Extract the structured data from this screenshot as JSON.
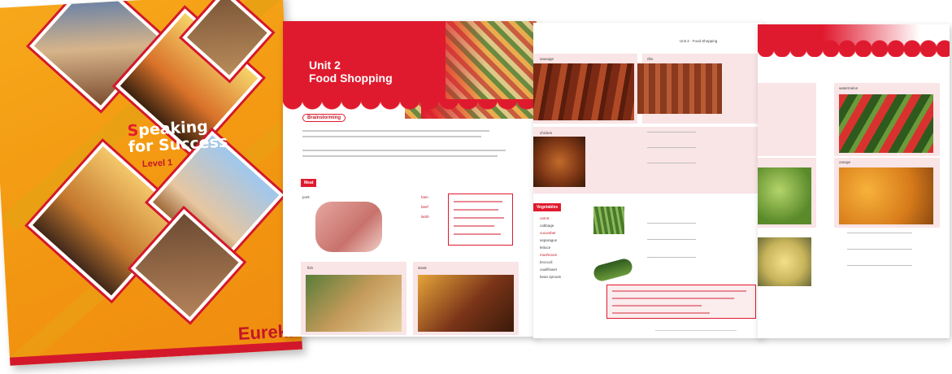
{
  "cover": {
    "title_first_letter": "S",
    "title_line1_rest": "peaking",
    "title_line2": "for Success",
    "level": "Level 1",
    "publisher": "Eureka"
  },
  "page1": {
    "unit": "Unit 2",
    "title": "Food Shopping",
    "section": "Brainstorming",
    "meat_tag": "Meat",
    "items": [
      "pork",
      "fish",
      "steak"
    ],
    "list_items": [
      "ham",
      "beef",
      "lamb"
    ]
  },
  "page2": {
    "header": "Unit 2 · Food Shopping",
    "items": [
      "sausage",
      "ribs",
      "chicken"
    ],
    "vegetables_tag": "Vegetables",
    "vegetable_list": [
      "carrot",
      "cabbage",
      "cucumber",
      "asparagus",
      "lettuce",
      "mushroom",
      "broccoli",
      "cauliflower",
      "bean sprouts"
    ]
  },
  "page3": {
    "items": [
      "watermelon",
      "orange"
    ]
  }
}
